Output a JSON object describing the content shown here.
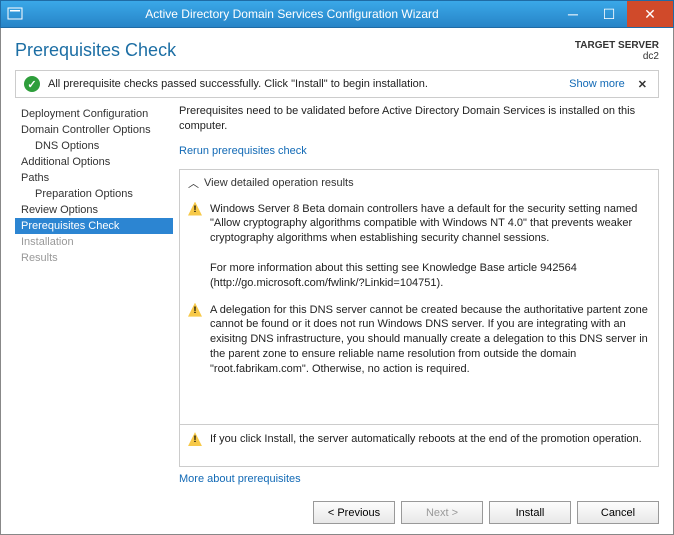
{
  "titlebar": {
    "title": "Active Directory Domain Services Configuration Wizard"
  },
  "header": {
    "page_title": "Prerequisites Check",
    "target_label": "TARGET SERVER",
    "target_value": "dc2"
  },
  "status": {
    "message": "All prerequisite checks passed successfully. Click \"Install\" to begin installation.",
    "show_more": "Show more"
  },
  "sidebar": {
    "items": [
      {
        "label": "Deployment Configuration",
        "sub": false
      },
      {
        "label": "Domain Controller Options",
        "sub": false
      },
      {
        "label": "DNS Options",
        "sub": true
      },
      {
        "label": "Additional Options",
        "sub": false
      },
      {
        "label": "Paths",
        "sub": false
      },
      {
        "label": "Preparation Options",
        "sub": true
      },
      {
        "label": "Review Options",
        "sub": false
      },
      {
        "label": "Prerequisites Check",
        "sub": false,
        "active": true
      },
      {
        "label": "Installation",
        "sub": false,
        "disabled": true
      },
      {
        "label": "Results",
        "sub": false,
        "disabled": true
      }
    ]
  },
  "content": {
    "intro": "Prerequisites need to be validated before Active Directory Domain Services is installed on this computer.",
    "rerun": "Rerun prerequisites check",
    "results_header": "View detailed operation results",
    "warnings": [
      "Windows Server 8 Beta domain controllers have a default for the security setting named \"Allow cryptography algorithms compatible with Windows NT 4.0\" that prevents weaker cryptography algorithms when establishing security channel sessions.\n\nFor more information about this setting see Knowledge Base article 942564 (http://go.microsoft.com/fwlink/?Linkid=104751).",
      "A delegation for this DNS server cannot be created because the authoritative partent zone cannot be found or it does not run Windows DNS server. If you are integrating with an exisitng DNS infrastructure, you should manually create a delegation to this DNS server in the parent zone to ensure reliable name resolution from outside the domain \"root.fabrikam.com\". Otherwise, no action is required."
    ],
    "install_warning": "If you click Install, the server automatically reboots at the end of the promotion operation.",
    "more_link": "More about prerequisites"
  },
  "buttons": {
    "previous": "< Previous",
    "next": "Next >",
    "install": "Install",
    "cancel": "Cancel"
  }
}
